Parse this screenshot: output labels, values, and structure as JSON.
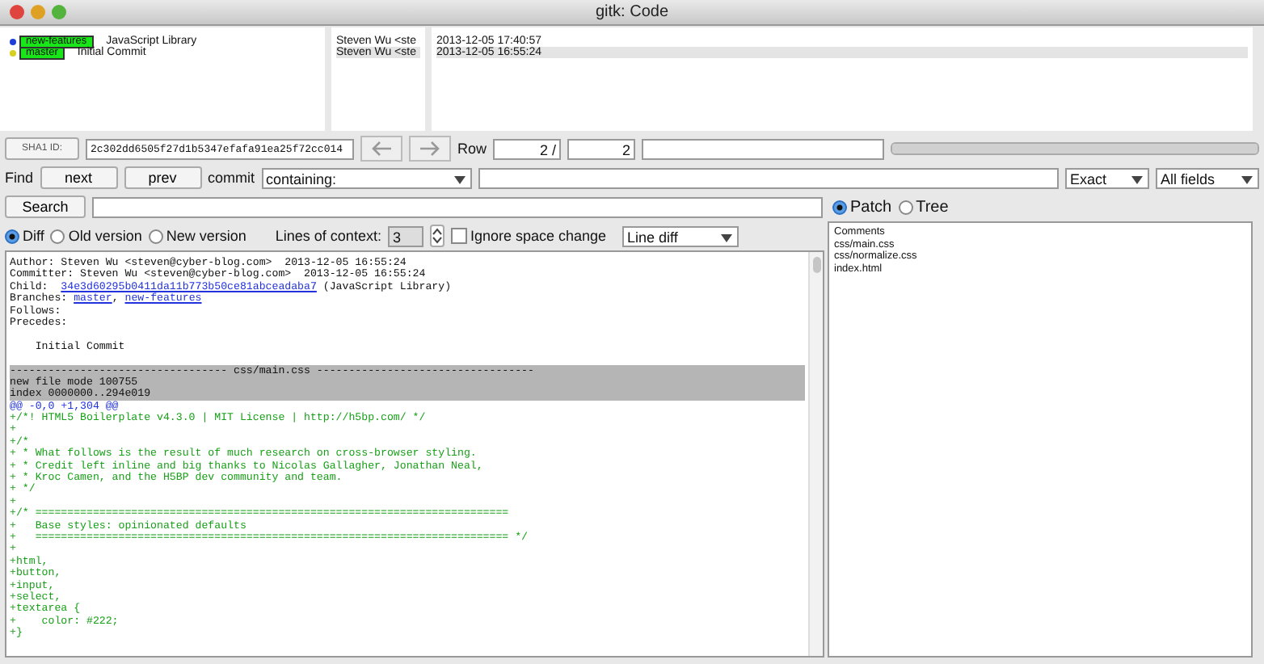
{
  "window": {
    "title": "gitk: Code"
  },
  "commits": [
    {
      "branches": [
        "new-features"
      ],
      "message": "JavaScript Library",
      "author": "Steven Wu <ste",
      "date": "2013-12-05 17:40:57",
      "color": "#1f3fd8",
      "selected": false
    },
    {
      "branches": [
        "master"
      ],
      "message": "Initial Commit",
      "author": "Steven Wu <ste",
      "date": "2013-12-05 16:55:24",
      "color": "#d8d020",
      "selected": true
    }
  ],
  "sha_bar": {
    "button": "SHA1 ID:",
    "sha": "2c302dd6505f27d1b5347efafa91ea25f72cc014",
    "row_label": "Row",
    "row_current": "2 /",
    "row_total": "2",
    "progress": {
      "level": 1
    }
  },
  "find_bar": {
    "label": "Find",
    "next": "next",
    "prev": "prev",
    "commit_label": "commit",
    "mode": "containing:",
    "match": "Exact",
    "fields": "All fields"
  },
  "search": {
    "button": "Search"
  },
  "diff_options": {
    "views": [
      {
        "label": "Diff",
        "selected": true
      },
      {
        "label": "Old version",
        "selected": false
      },
      {
        "label": "New version",
        "selected": false
      }
    ],
    "context_label": "Lines of context:",
    "context_value": "3",
    "ignore_space": {
      "label": "Ignore space change",
      "checked": false
    },
    "diff_mode": "Line diff"
  },
  "diff_lines": [
    {
      "kind": "meta",
      "parts": [
        {
          "text": "Author: Steven Wu <steven@cyber-blog.com>  2013-12-05 16:55:24",
          "kind": "text"
        }
      ]
    },
    {
      "kind": "meta",
      "parts": [
        {
          "text": "Committer: Steven Wu <steven@cyber-blog.com>  2013-12-05 16:55:24",
          "kind": "text"
        }
      ]
    },
    {
      "kind": "meta",
      "parts": [
        {
          "text": "Child:  ",
          "kind": "text"
        },
        {
          "text": "34e3d60295b0411da11b773b50ce81abceadaba7",
          "kind": "link"
        },
        {
          "text": " (JavaScript Library)",
          "kind": "text"
        }
      ]
    },
    {
      "kind": "meta",
      "parts": [
        {
          "text": "Branches: ",
          "kind": "text"
        },
        {
          "text": "master",
          "kind": "link"
        },
        {
          "text": ", ",
          "kind": "text"
        },
        {
          "text": "new-features",
          "kind": "link"
        }
      ]
    },
    {
      "kind": "meta",
      "parts": [
        {
          "text": "Follows:",
          "kind": "text"
        }
      ]
    },
    {
      "kind": "meta",
      "parts": [
        {
          "text": "Precedes:",
          "kind": "text"
        }
      ]
    },
    {
      "kind": "blank"
    },
    {
      "kind": "message",
      "text": "    Initial Commit"
    },
    {
      "kind": "blank"
    },
    {
      "kind": "file",
      "text": "---------------------------------- css/main.css ----------------------------------"
    },
    {
      "kind": "file",
      "text": "new file mode 100755"
    },
    {
      "kind": "file",
      "text": "index 0000000..294e019"
    },
    {
      "kind": "hunk",
      "text": "@@ -0,0 +1,304 @@"
    },
    {
      "kind": "add",
      "text": "+/*! HTML5 Boilerplate v4.3.0 | MIT License | http://h5bp.com/ */"
    },
    {
      "kind": "add",
      "text": "+"
    },
    {
      "kind": "add",
      "text": "+/*"
    },
    {
      "kind": "add",
      "text": "+ * What follows is the result of much research on cross-browser styling."
    },
    {
      "kind": "add",
      "text": "+ * Credit left inline and big thanks to Nicolas Gallagher, Jonathan Neal,"
    },
    {
      "kind": "add",
      "text": "+ * Kroc Camen, and the H5BP dev community and team."
    },
    {
      "kind": "add",
      "text": "+ */"
    },
    {
      "kind": "add",
      "text": "+"
    },
    {
      "kind": "add",
      "text": "+/* =========================================================================="
    },
    {
      "kind": "add",
      "text": "+   Base styles: opinionated defaults"
    },
    {
      "kind": "add",
      "text": "+   ========================================================================== */"
    },
    {
      "kind": "add",
      "text": "+"
    },
    {
      "kind": "add",
      "text": "+html,"
    },
    {
      "kind": "add",
      "text": "+button,"
    },
    {
      "kind": "add",
      "text": "+input,"
    },
    {
      "kind": "add",
      "text": "+select,"
    },
    {
      "kind": "add",
      "text": "+textarea {"
    },
    {
      "kind": "add",
      "text": "+    color: #222;"
    },
    {
      "kind": "add",
      "text": "+}"
    }
  ],
  "view_mode": [
    {
      "label": "Patch",
      "selected": true
    },
    {
      "label": "Tree",
      "selected": false
    }
  ],
  "files": [
    "Comments",
    "css/main.css",
    "css/normalize.css",
    "index.html"
  ]
}
